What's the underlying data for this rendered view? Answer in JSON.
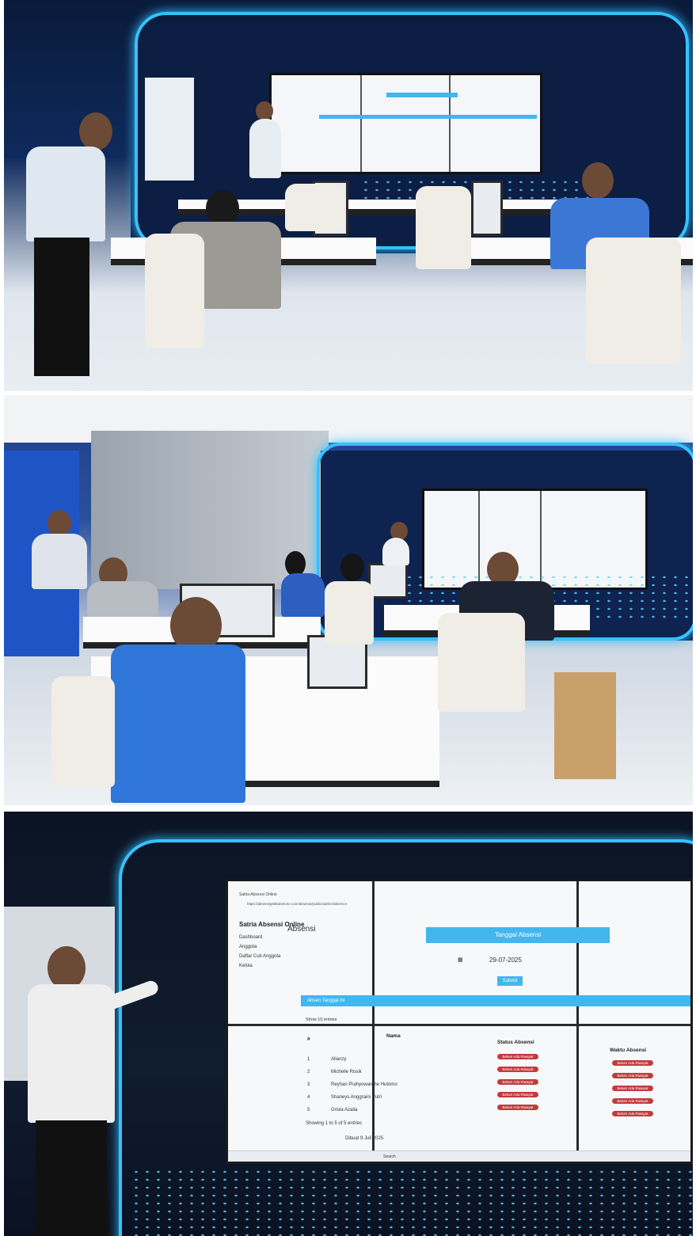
{
  "panel3_screen": {
    "browser_tab": "Satria Absensi Online",
    "url": "https://absensigeitbuketone.com/absensi/public/admin/absence",
    "app_title": "Satria Absensi Online",
    "sidebar": [
      "Dashboard",
      "Anggota",
      "Daftar Cuti Anggota",
      "Kelola"
    ],
    "page_heading": "Absensi",
    "date_heading": "Tanggal Absensi",
    "date_value": "29-07-2025",
    "submit_label": "Submit",
    "band_label": "Absen Tanggal ini",
    "show_entries": "Show 10 entries",
    "columns": [
      "#",
      "Nama",
      "Status Absensi",
      "Waktu Absensi"
    ],
    "rows": [
      {
        "num": "1",
        "name": "Allanzy"
      },
      {
        "num": "2",
        "name": "Michelle Rosik"
      },
      {
        "num": "3",
        "name": "Reyhan Prahyowardhe Hutomo"
      },
      {
        "num": "4",
        "name": "Shaneys Anggraini Putri"
      },
      {
        "num": "5",
        "name": "Grisla Azalia"
      }
    ],
    "status_pill": "Belum Ada Riwayat",
    "footer_showing": "Showing 1 to 5 of 5 entries",
    "footer_credit": "Dibuat 9 Juli 2025",
    "taskbar_search": "Search"
  },
  "colors": {
    "accent": "#41b6ef",
    "pill": "#c23b3b",
    "neon": "#35c2ff"
  }
}
